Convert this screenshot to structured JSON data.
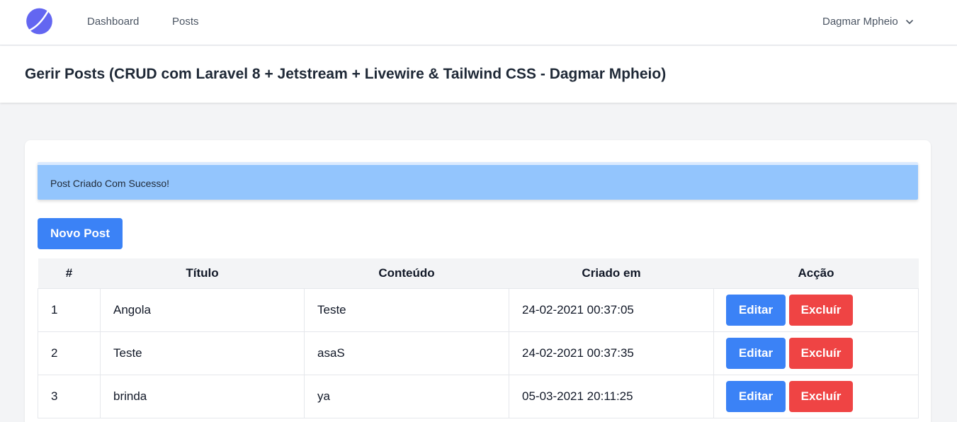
{
  "nav": {
    "links": [
      "Dashboard",
      "Posts"
    ],
    "user_name": "Dagmar Mpheio",
    "colors": {
      "logo": "#6366f1"
    }
  },
  "header": {
    "title": "Gerir Posts (CRUD com Laravel 8 + Jetstream + Livewire & Tailwind CSS - Dagmar Mpheio)"
  },
  "alert": {
    "message": "Post Criado Com Sucesso!",
    "color": "#93c5fd"
  },
  "toolbar": {
    "new_post_label": "Novo Post"
  },
  "table": {
    "columns": [
      "#",
      "Título",
      "Conteúdo",
      "Criado em",
      "Acção"
    ],
    "rows": [
      {
        "id": "1",
        "title": "Angola",
        "content": "Teste",
        "created": "24-02-2021 00:37:05"
      },
      {
        "id": "2",
        "title": "Teste",
        "content": "asaS",
        "created": "24-02-2021 00:37:35"
      },
      {
        "id": "3",
        "title": "brinda",
        "content": "ya",
        "created": "05-03-2021 20:11:25"
      }
    ],
    "edit_label": "Editar",
    "delete_label": "Excluír",
    "colors": {
      "edit": "#3b82f6",
      "delete": "#ef4444"
    }
  }
}
